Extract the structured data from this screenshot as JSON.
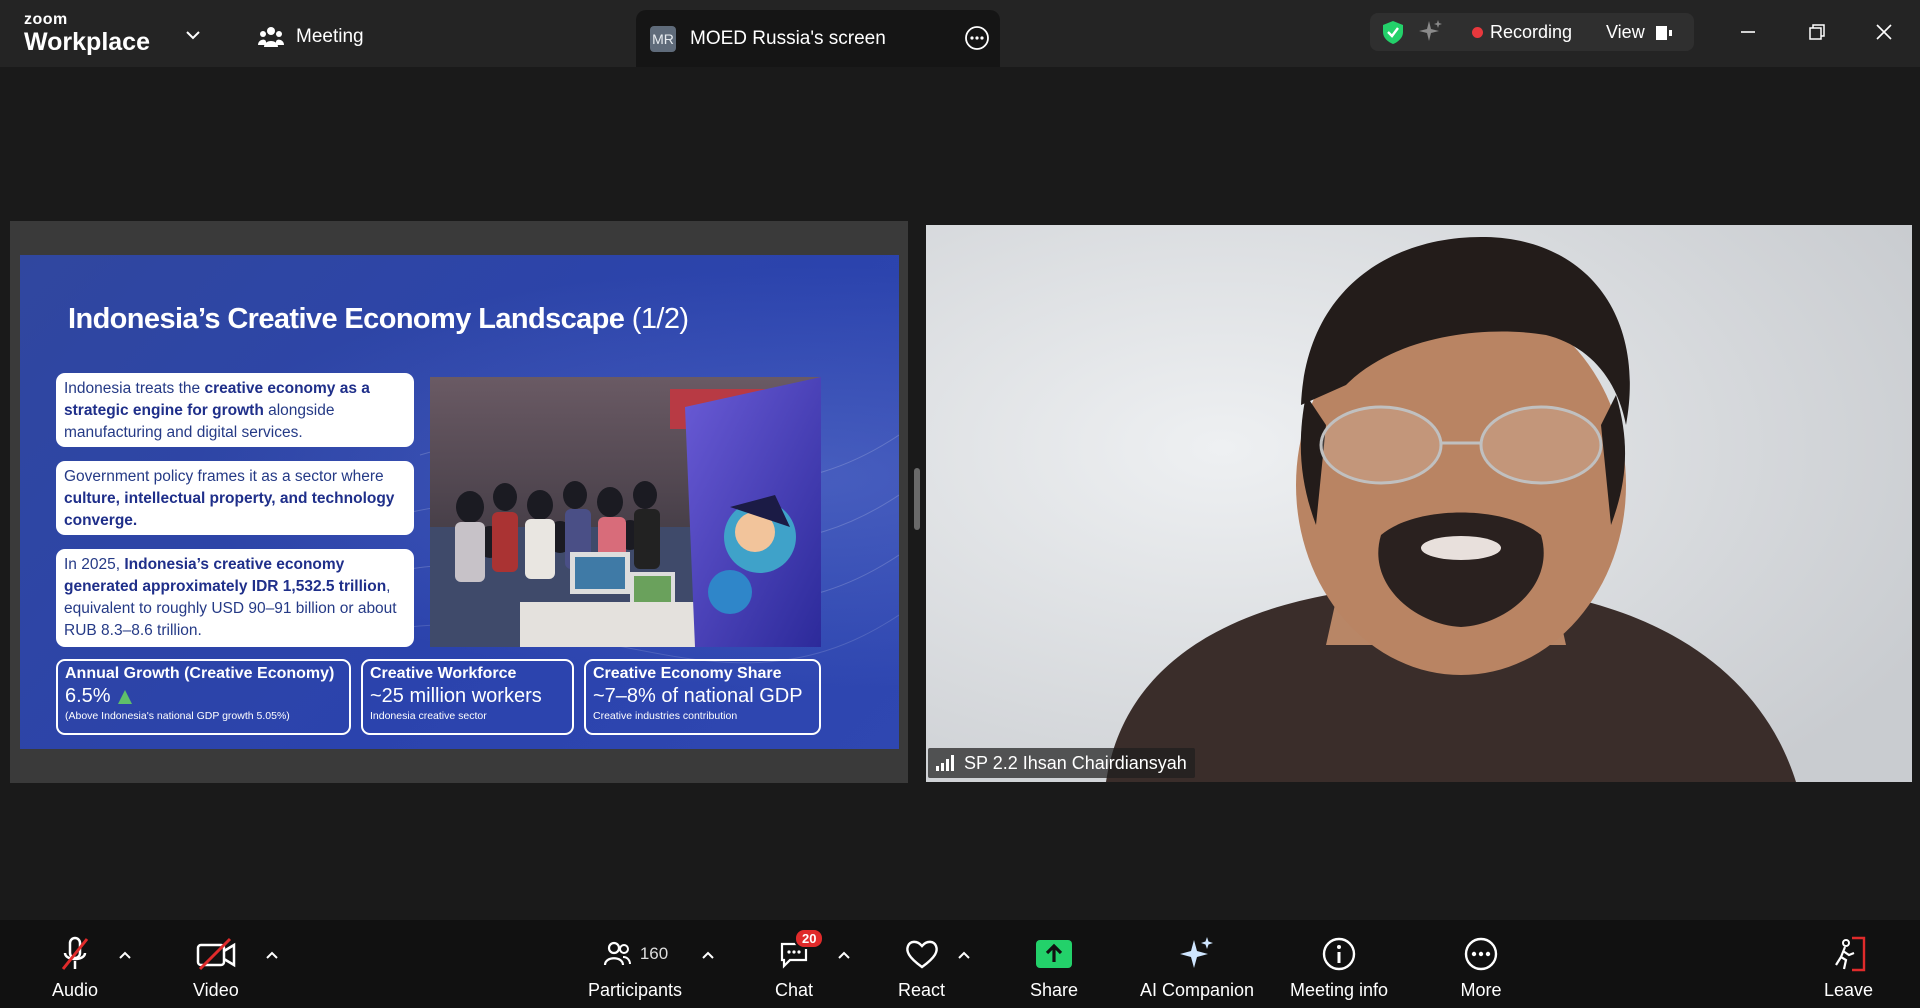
{
  "app": {
    "brand_top": "zoom",
    "brand_bottom": "Workplace",
    "meeting_label": "Meeting"
  },
  "screen_tab": {
    "initials": "MR",
    "label": "MOED Russia's screen"
  },
  "status": {
    "recording_label": "Recording",
    "view_label": "View"
  },
  "slide": {
    "title": "Indonesia’s Creative Economy Landscape",
    "title_suffix": "(1/2)",
    "box1": {
      "t1": "Indonesia treats the ",
      "b1": "creative economy as a strategic engine for growth",
      "t2": " alongside manufacturing and digital services."
    },
    "box2": {
      "t1": "Government policy frames it as a sector where ",
      "b1": "culture, intellectual property, and technology converge."
    },
    "box3": {
      "t1": "In 2025, ",
      "b1": "Indonesia’s creative economy generated approximately IDR 1,532.5 trillion",
      "t2": ", equivalent to roughly USD 90–91 billion or about RUB 8.3–8.6 trillion."
    },
    "stats": [
      {
        "title": "Annual Growth (Creative Economy)",
        "value": "6.5%",
        "note": "(Above Indonesia's national GDP growth 5.05%)"
      },
      {
        "title": "Creative Workforce",
        "value": "~25 million workers",
        "note": "Indonesia creative sector"
      },
      {
        "title": "Creative Economy Share",
        "value": "~7–8% of national GDP",
        "note": "Creative industries contribution"
      }
    ]
  },
  "participant": {
    "name": "SP 2.2 Ihsan Chairdiansyah"
  },
  "toolbar": {
    "audio": "Audio",
    "video": "Video",
    "participants": "Participants",
    "participants_count": "160",
    "chat": "Chat",
    "chat_badge": "20",
    "react": "React",
    "share": "Share",
    "ai": "AI Companion",
    "info": "Meeting info",
    "more": "More",
    "leave": "Leave"
  },
  "colors": {
    "accent_green": "#23d16a",
    "recording_red": "#e8383d",
    "slide_blue": "#2e44a8"
  }
}
